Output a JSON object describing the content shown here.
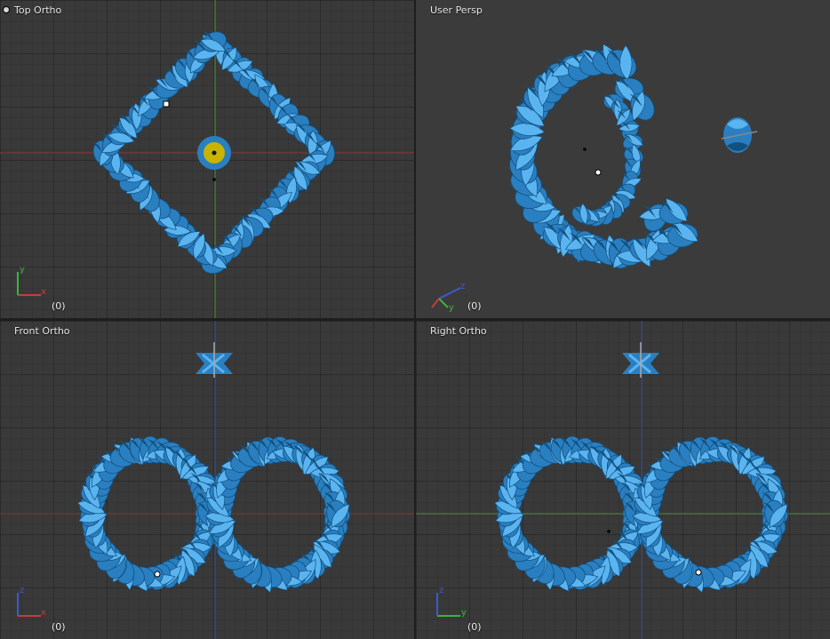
{
  "viewports": [
    {
      "label": "Top Ortho",
      "frame": "(0)",
      "axes": [
        "y",
        "x"
      ]
    },
    {
      "label": "User Persp",
      "frame": "(0)",
      "axes": [
        "z",
        "y"
      ]
    },
    {
      "label": "Front Ortho",
      "frame": "(0)",
      "axes": [
        "z",
        "x"
      ]
    },
    {
      "label": "Right Ortho",
      "frame": "(0)",
      "axes": [
        "z",
        "y"
      ]
    }
  ],
  "colors": {
    "background": "#393939",
    "object_blue": "#2a7fc0",
    "object_blue_light": "#5ab4f0",
    "object_blue_dark": "#12507f",
    "axis_x": "#c83c3c",
    "axis_y": "#3cb43c",
    "axis_z": "#3c5ad2",
    "selected_yellow": "#c8b400"
  },
  "icons": {
    "viewport_menu": "circle-dot-icon"
  }
}
